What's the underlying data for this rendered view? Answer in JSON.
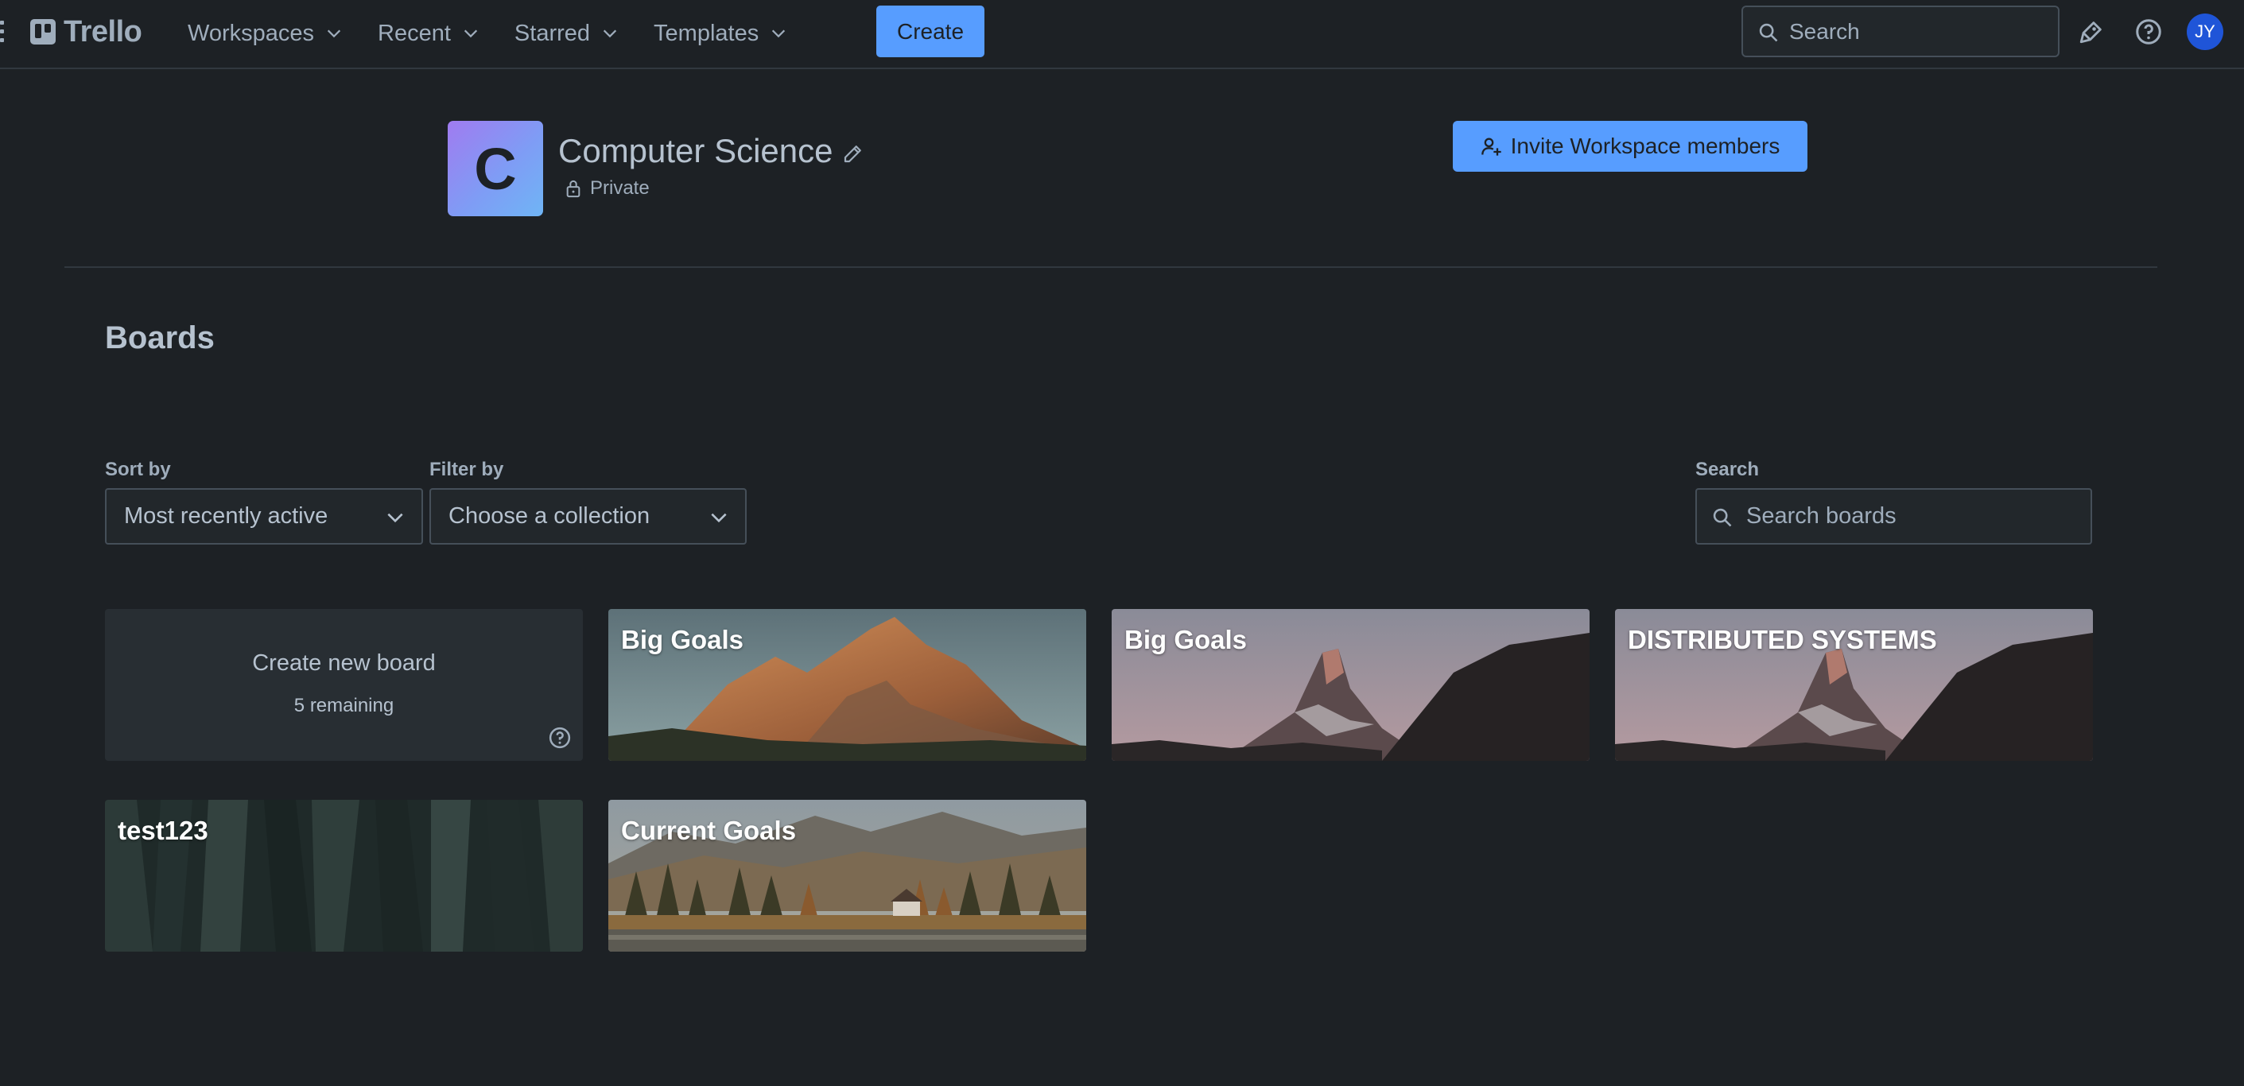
{
  "nav": {
    "logo_text": "Trello",
    "menu": [
      {
        "label": "Workspaces"
      },
      {
        "label": "Recent"
      },
      {
        "label": "Starred"
      },
      {
        "label": "Templates"
      }
    ],
    "create_label": "Create",
    "search_placeholder": "Search",
    "avatar_initials": "JY",
    "icons": [
      "notifications-icon",
      "help-icon"
    ]
  },
  "workspace": {
    "logo_letter": "C",
    "name": "Computer Science",
    "visibility": "Private",
    "invite_label": "Invite Workspace members"
  },
  "boards_section": {
    "heading": "Boards",
    "sort_label": "Sort by",
    "sort_value": "Most recently active",
    "filter_label": "Filter by",
    "filter_value": "Choose a collection",
    "search_label": "Search",
    "search_placeholder": "Search boards"
  },
  "create_board": {
    "label": "Create new board",
    "remaining": "5 remaining"
  },
  "boards": [
    {
      "title": "Big Goals",
      "background": "dolomites-peak"
    },
    {
      "title": "Big Goals",
      "background": "matterhorn-dusk"
    },
    {
      "title": "DISTRIBUTED SYSTEMS",
      "background": "matterhorn-dusk"
    },
    {
      "title": "test123",
      "background": "dark-green-texture"
    },
    {
      "title": "Current Goals",
      "background": "mountain-lake-cabin"
    }
  ],
  "colors": {
    "page_bg": "#1d2125",
    "accent": "#579dff",
    "text": "#b6c2cf",
    "subtle_text": "#9fadbc",
    "avatar": "#1f55d8"
  }
}
